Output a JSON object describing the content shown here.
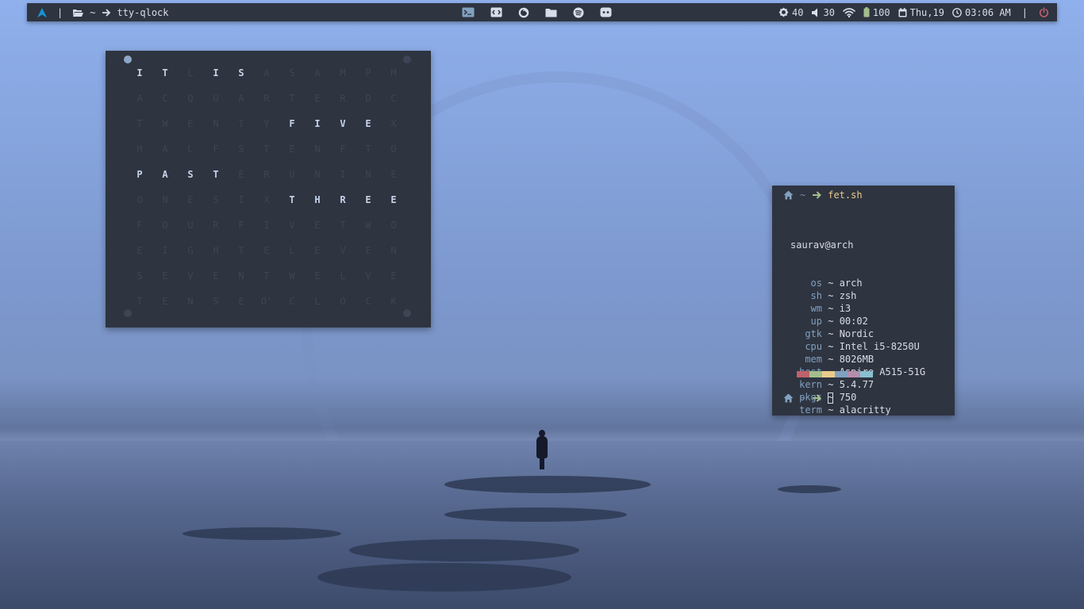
{
  "topbar": {
    "left": {
      "launcher_icon": "arch-logo-icon",
      "separator": "|",
      "folder_icon": "folder-open-icon",
      "path": "~",
      "arrow_icon": "arrow-right-icon",
      "window_title": "tty-qlock"
    },
    "center_apps": [
      {
        "name": "terminal-icon"
      },
      {
        "name": "code-editor-icon"
      },
      {
        "name": "firefox-icon"
      },
      {
        "name": "files-icon"
      },
      {
        "name": "spotify-icon"
      },
      {
        "name": "discord-icon"
      }
    ],
    "right": {
      "brightness": "40",
      "volume": "30",
      "wifi_icon": "wifi-icon",
      "battery": "100",
      "date": "Thu,19",
      "time": "03:06 AM",
      "separator": "|",
      "power_icon": "power-icon"
    }
  },
  "qlock": {
    "rows": [
      [
        "I",
        "T",
        "L",
        "I",
        "S",
        "A",
        "S",
        "A",
        "M",
        "P",
        "M"
      ],
      [
        "A",
        "C",
        "Q",
        "U",
        "A",
        "R",
        "T",
        "E",
        "R",
        "D",
        "C"
      ],
      [
        "T",
        "W",
        "E",
        "N",
        "T",
        "Y",
        "F",
        "I",
        "V",
        "E",
        "X"
      ],
      [
        "H",
        "A",
        "L",
        "F",
        "S",
        "T",
        "E",
        "N",
        "F",
        "T",
        "O"
      ],
      [
        "P",
        "A",
        "S",
        "T",
        "E",
        "R",
        "U",
        "N",
        "I",
        "N",
        "E"
      ],
      [
        "O",
        "N",
        "E",
        "S",
        "I",
        "X",
        "T",
        "H",
        "R",
        "E",
        "E"
      ],
      [
        "F",
        "O",
        "U",
        "R",
        "F",
        "I",
        "V",
        "E",
        "T",
        "W",
        "O"
      ],
      [
        "E",
        "I",
        "G",
        "H",
        "T",
        "E",
        "L",
        "E",
        "V",
        "E",
        "N"
      ],
      [
        "S",
        "E",
        "V",
        "E",
        "N",
        "T",
        "W",
        "E",
        "L",
        "V",
        "E"
      ],
      [
        "T",
        "E",
        "N",
        "S",
        "E",
        "O'",
        "C",
        "L",
        "O",
        "C",
        "K"
      ]
    ],
    "lit": [
      [
        0,
        0
      ],
      [
        0,
        1
      ],
      [
        0,
        3
      ],
      [
        0,
        4
      ],
      [
        2,
        6
      ],
      [
        2,
        7
      ],
      [
        2,
        8
      ],
      [
        2,
        9
      ],
      [
        4,
        0
      ],
      [
        4,
        1
      ],
      [
        4,
        2
      ],
      [
        4,
        3
      ],
      [
        5,
        6
      ],
      [
        5,
        7
      ],
      [
        5,
        8
      ],
      [
        5,
        9
      ],
      [
        5,
        10
      ]
    ],
    "dots_lit": [
      true,
      false,
      false,
      false
    ]
  },
  "terminal": {
    "prompt_path": "~",
    "command": "fet.sh",
    "user_host": "saurav@arch",
    "info": [
      {
        "key": "os",
        "value": "arch"
      },
      {
        "key": "sh",
        "value": "zsh"
      },
      {
        "key": "wm",
        "value": "i3"
      },
      {
        "key": "up",
        "value": "00:02"
      },
      {
        "key": "gtk",
        "value": "Nordic"
      },
      {
        "key": "cpu",
        "value": "Intel i5-8250U"
      },
      {
        "key": "mem",
        "value": "8026MB"
      },
      {
        "key": "host",
        "value": "Aspire A515-51G"
      },
      {
        "key": "kern",
        "value": "5.4.77"
      },
      {
        "key": "pkgs",
        "value": "750"
      },
      {
        "key": "term",
        "value": "alacritty"
      }
    ],
    "separator": "~",
    "palette": [
      "#bf616a",
      "#a3be8c",
      "#ebcb8b",
      "#81a1c1",
      "#b48ead",
      "#88c0d0"
    ],
    "second_prompt_path": "~"
  }
}
